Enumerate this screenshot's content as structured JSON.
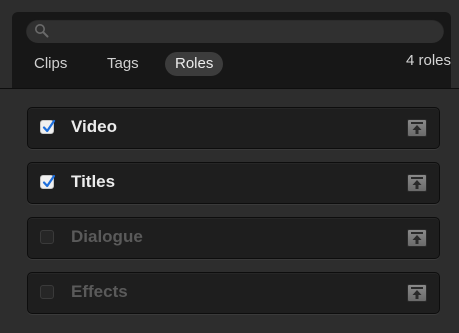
{
  "search": {
    "placeholder": "",
    "icon": "search-icon"
  },
  "tabs": [
    {
      "label": "Clips",
      "active": false
    },
    {
      "label": "Tags",
      "active": false
    },
    {
      "label": "Roles",
      "active": true
    }
  ],
  "count_label": "4 roles",
  "roles": [
    {
      "label": "Video",
      "checked": true
    },
    {
      "label": "Titles",
      "checked": true
    },
    {
      "label": "Dialogue",
      "checked": false
    },
    {
      "label": "Effects",
      "checked": false
    }
  ],
  "colors": {
    "checkmark": "#1e6fdc",
    "background": "#2d2d2d",
    "header_background": "#171717"
  }
}
